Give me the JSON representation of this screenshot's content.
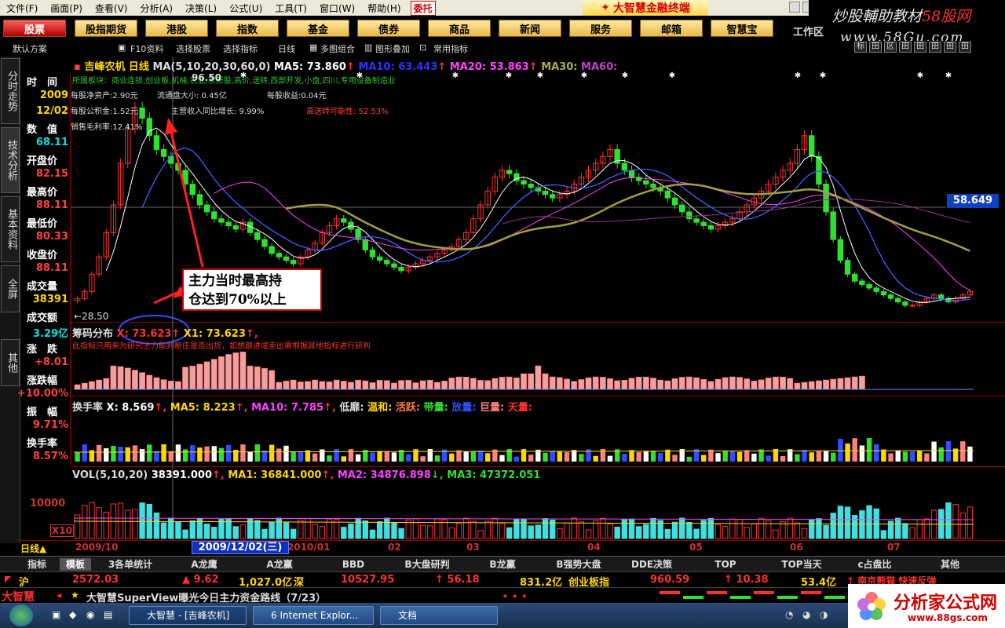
{
  "menu": {
    "items": [
      "文件(F)",
      "画面(P)",
      "查看(V)",
      "分析(A)",
      "决策(L)",
      "公式(U)",
      "工具(T)",
      "窗口(W)",
      "帮助(H)"
    ],
    "brand_button": "委托",
    "app_title": "大智慧金融终端"
  },
  "watermark": {
    "line1_a": "炒股輔助教材",
    "line1_b": "58股网",
    "line2": "www.58Gu.com"
  },
  "nav": {
    "buttons": [
      "股票",
      "股指期货",
      "港股",
      "指数",
      "基金",
      "债券",
      "商品",
      "新闻",
      "服务",
      "邮箱",
      "智慧宝"
    ],
    "active": 0,
    "workspace": "工作区"
  },
  "toolbar": {
    "items": [
      "默认方案",
      "F10资料",
      "选择股票",
      "选择指标",
      "日线",
      "多图组合",
      "图形叠加",
      "常用指标"
    ],
    "right_icons": [
      "标",
      "田",
      "区",
      "田",
      "田",
      "田",
      "田",
      "田"
    ]
  },
  "side_tabs": [
    "分时走势",
    "技术分析",
    "基本资料",
    "全屏",
    "其他"
  ],
  "info": {
    "rows": [
      {
        "label": "时　间",
        "value": "2009",
        "color": "#ffd700"
      },
      {
        "label": "",
        "value": "12/02",
        "color": "#ffd700"
      },
      {
        "label": "数　值",
        "value": "68.11",
        "color": "#00e0e0"
      },
      {
        "label": "开盘价",
        "value": "82.15",
        "color": "#ff4040"
      },
      {
        "label": "最高价",
        "value": "88.11",
        "color": "#ff4040"
      },
      {
        "label": "最低价",
        "value": "80.33",
        "color": "#ff4040"
      },
      {
        "label": "收盘价",
        "value": "88.11",
        "color": "#ff4040"
      },
      {
        "label": "成交量",
        "value": "38391",
        "color": "#ffd700"
      },
      {
        "label": "成交额",
        "value": "3.29亿",
        "color": "#00e0e0"
      },
      {
        "label": "涨　跌",
        "value": "+8.01",
        "color": "#ff4040"
      },
      {
        "label": "涨跌幅",
        "value": "+10.00%",
        "color": "#ff4040"
      },
      {
        "label": "振　幅",
        "value": "9.71%",
        "color": "#ff4040"
      },
      {
        "label": "换手率",
        "value": "8.57%",
        "color": "#ff4040"
      }
    ]
  },
  "price_panel": {
    "stock": "吉峰农机",
    "period": "日线",
    "ma_spec": "MA(5,10,20,30,60,0)",
    "ma5": "MA5: 73.860",
    "ma10": "MA10: 63.443",
    "ma20": "MA20: 53.863",
    "ma30": "MA30:",
    "ma60": "MA60:",
    "max_label": "96.50",
    "min_label": "←28.50",
    "right_value": "58.649",
    "fund_line": "所属板块：商业连锁,创业板,机械,农业,次新股,高价,送转,西部开发,小盘,四川,专用设备制造业",
    "fund_a": "每股净资产:2.90元",
    "fund_b": "流通盘大小: 0.45亿",
    "fund_c": "每股收益:0.04元",
    "fund_d": "每股公积金:1.52元",
    "fund_e": "主营收入同比增长: 9.99%",
    "fund_f": "高送转可能性: 52.53%",
    "fund_g": "销售毛利率:12.41%"
  },
  "annotation": {
    "line1": "主力当时最高持",
    "line2": "仓达到70%以上"
  },
  "chip_panel": {
    "title": "筹码分布",
    "x": "X: 73.623",
    "x1": "X1: 73.623",
    "note": "此指标只用来为研究主力能判断庄是否出货，如想跟进或卖出需根据其他指标进行研判"
  },
  "turnover_panel": {
    "title": "换手率",
    "x": "X: 8.569",
    "ma5": "MA5: 8.223",
    "ma10": "MA10: 7.785",
    "low": "低靡:",
    "warm": "温和:",
    "active": "活跃:",
    "heavy": "带量:",
    "big": "放量:",
    "huge": "巨量:",
    "sky": "天量:"
  },
  "vol_panel": {
    "title": "VOL(5,10,20)",
    "value": "38391.000",
    "ma1": "MA1: 36841.000",
    "ma2": "MA2: 34876.898",
    "ma3": "MA3: 47372.051",
    "axis": "10000",
    "unit": "X10"
  },
  "date_bar": {
    "period": "日线▲",
    "dates": [
      "2009/10",
      "2010/01",
      "02",
      "03",
      "04",
      "05",
      "06",
      "07"
    ],
    "selected": "2009/12/02(三)"
  },
  "bottom_tabs": [
    "指标",
    "模板",
    "3各单统计",
    "A龙鹰",
    "A龙赢",
    "BBD",
    "B大盘研判",
    "B龙赢",
    "B强势大盘",
    "DDE决策",
    "TOP",
    "TOP当天",
    "c占盘比",
    "其他"
  ],
  "ticker": {
    "sh": "沪",
    "sh_index": "2572.03",
    "sh_chg": "▲ 9.62",
    "sh_amt": "1,027.0亿",
    "sz": "深",
    "sz_index": "10527.95",
    "sz_chg": "↑ 56.18",
    "sz_amt": "831.2亿",
    "gem": "创业板指",
    "gem_index": "960.59",
    "gem_chg": "↑ 10.38",
    "gem_amt": "53.4亿",
    "news_hint": "↑ 南京熊猫 快速反弹"
  },
  "status": {
    "logo": "大智慧",
    "message": "大智慧SuperView曝光今日主力资金路线（7/23）"
  },
  "taskbar": {
    "items": [
      "大智慧 - [吉峰农机]",
      "6 Internet Explor...",
      "文档"
    ]
  },
  "site_logo": {
    "name": "分析家公式网",
    "url": "www.88gs.com"
  },
  "chart_data": {
    "type": "candlestick",
    "title": "吉峰农机 日线",
    "ylim": [
      28.5,
      96.5
    ],
    "close": [
      33,
      35,
      40,
      45,
      52,
      60,
      72,
      82,
      88,
      85,
      80,
      76,
      74,
      72,
      70,
      66,
      63,
      60,
      58,
      56,
      55,
      54,
      53,
      55,
      52,
      50,
      48,
      46,
      45,
      44,
      43,
      45,
      47,
      49,
      52,
      54,
      56,
      55,
      53,
      50,
      47,
      45,
      44,
      43,
      42,
      41,
      42,
      43,
      44,
      45,
      46,
      47,
      48,
      50,
      52,
      56,
      60,
      64,
      68,
      70,
      69,
      67,
      66,
      65,
      64,
      63,
      62,
      63,
      64,
      66,
      68,
      70,
      72,
      74,
      76,
      72,
      70,
      68,
      67,
      66,
      65,
      64,
      62,
      60,
      58,
      56,
      55,
      54,
      53,
      54,
      55,
      56,
      58,
      60,
      62,
      64,
      66,
      68,
      70,
      72,
      76,
      80,
      74,
      66,
      58,
      50,
      44,
      40,
      38,
      37,
      36,
      35,
      34,
      33,
      32,
      31,
      31,
      32,
      33,
      34,
      33,
      32,
      33,
      34,
      35
    ]
  }
}
